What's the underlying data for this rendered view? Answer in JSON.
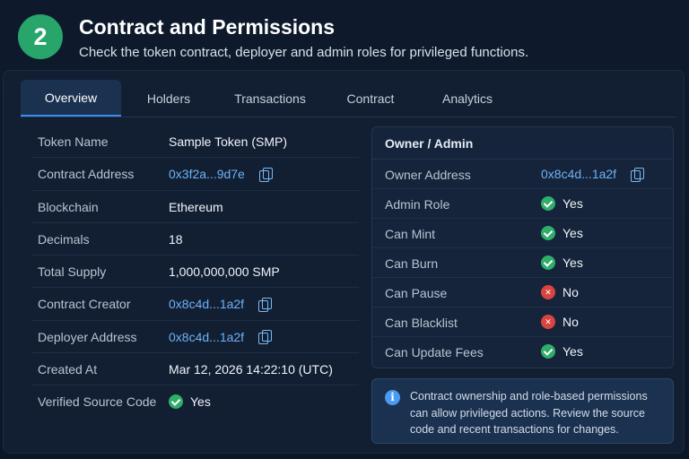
{
  "header": {
    "step": "2",
    "title": "Contract and Permissions",
    "subtitle": "Check the token contract, deployer and admin roles for privileged functions."
  },
  "tabs": [
    {
      "label": "Overview",
      "active": true
    },
    {
      "label": "Holders",
      "active": false
    },
    {
      "label": "Transactions",
      "active": false
    },
    {
      "label": "Contract",
      "active": false
    },
    {
      "label": "Analytics",
      "active": false
    }
  ],
  "overview": {
    "rows": [
      {
        "label": "Token Name",
        "value": "Sample Token (SMP)"
      },
      {
        "label": "Contract Address",
        "value": "0x3f2a...9d7e",
        "link": true,
        "copy": true
      },
      {
        "label": "Blockchain",
        "value": "Ethereum"
      },
      {
        "label": "Decimals",
        "value": "18"
      },
      {
        "label": "Total Supply",
        "value": "1,000,000,000 SMP"
      },
      {
        "label": "Contract Creator",
        "value": "0x8c4d...1a2f",
        "link": true,
        "copy": true
      },
      {
        "label": "Deployer Address",
        "value": "0x8c4d...1a2f",
        "link": true,
        "copy": true
      },
      {
        "label": "Created At",
        "value": "Mar 12, 2026 14:22:10 (UTC)"
      },
      {
        "label": "Verified Source Code",
        "value": "Yes",
        "status": "yes"
      }
    ]
  },
  "owner_admin": {
    "heading": "Owner / Admin",
    "rows": [
      {
        "label": "Owner Address",
        "value": "0x8c4d...1a2f",
        "link": true,
        "copy": true
      },
      {
        "label": "Admin Role",
        "value": "Yes",
        "status": "yes"
      },
      {
        "label": "Can Mint",
        "value": "Yes",
        "status": "yes"
      },
      {
        "label": "Can Burn",
        "value": "Yes",
        "status": "yes"
      },
      {
        "label": "Can Pause",
        "value": "No",
        "status": "no"
      },
      {
        "label": "Can Blacklist",
        "value": "No",
        "status": "no"
      },
      {
        "label": "Can Update Fees",
        "value": "Yes",
        "status": "yes"
      }
    ]
  },
  "info": {
    "text": "Contract ownership and role-based permissions can allow privileged actions. Review the source code and recent transactions for changes."
  },
  "colors": {
    "accent": "#3a8df0",
    "success": "#2fae6a",
    "danger": "#d9443f",
    "link": "#6fb2f5"
  }
}
